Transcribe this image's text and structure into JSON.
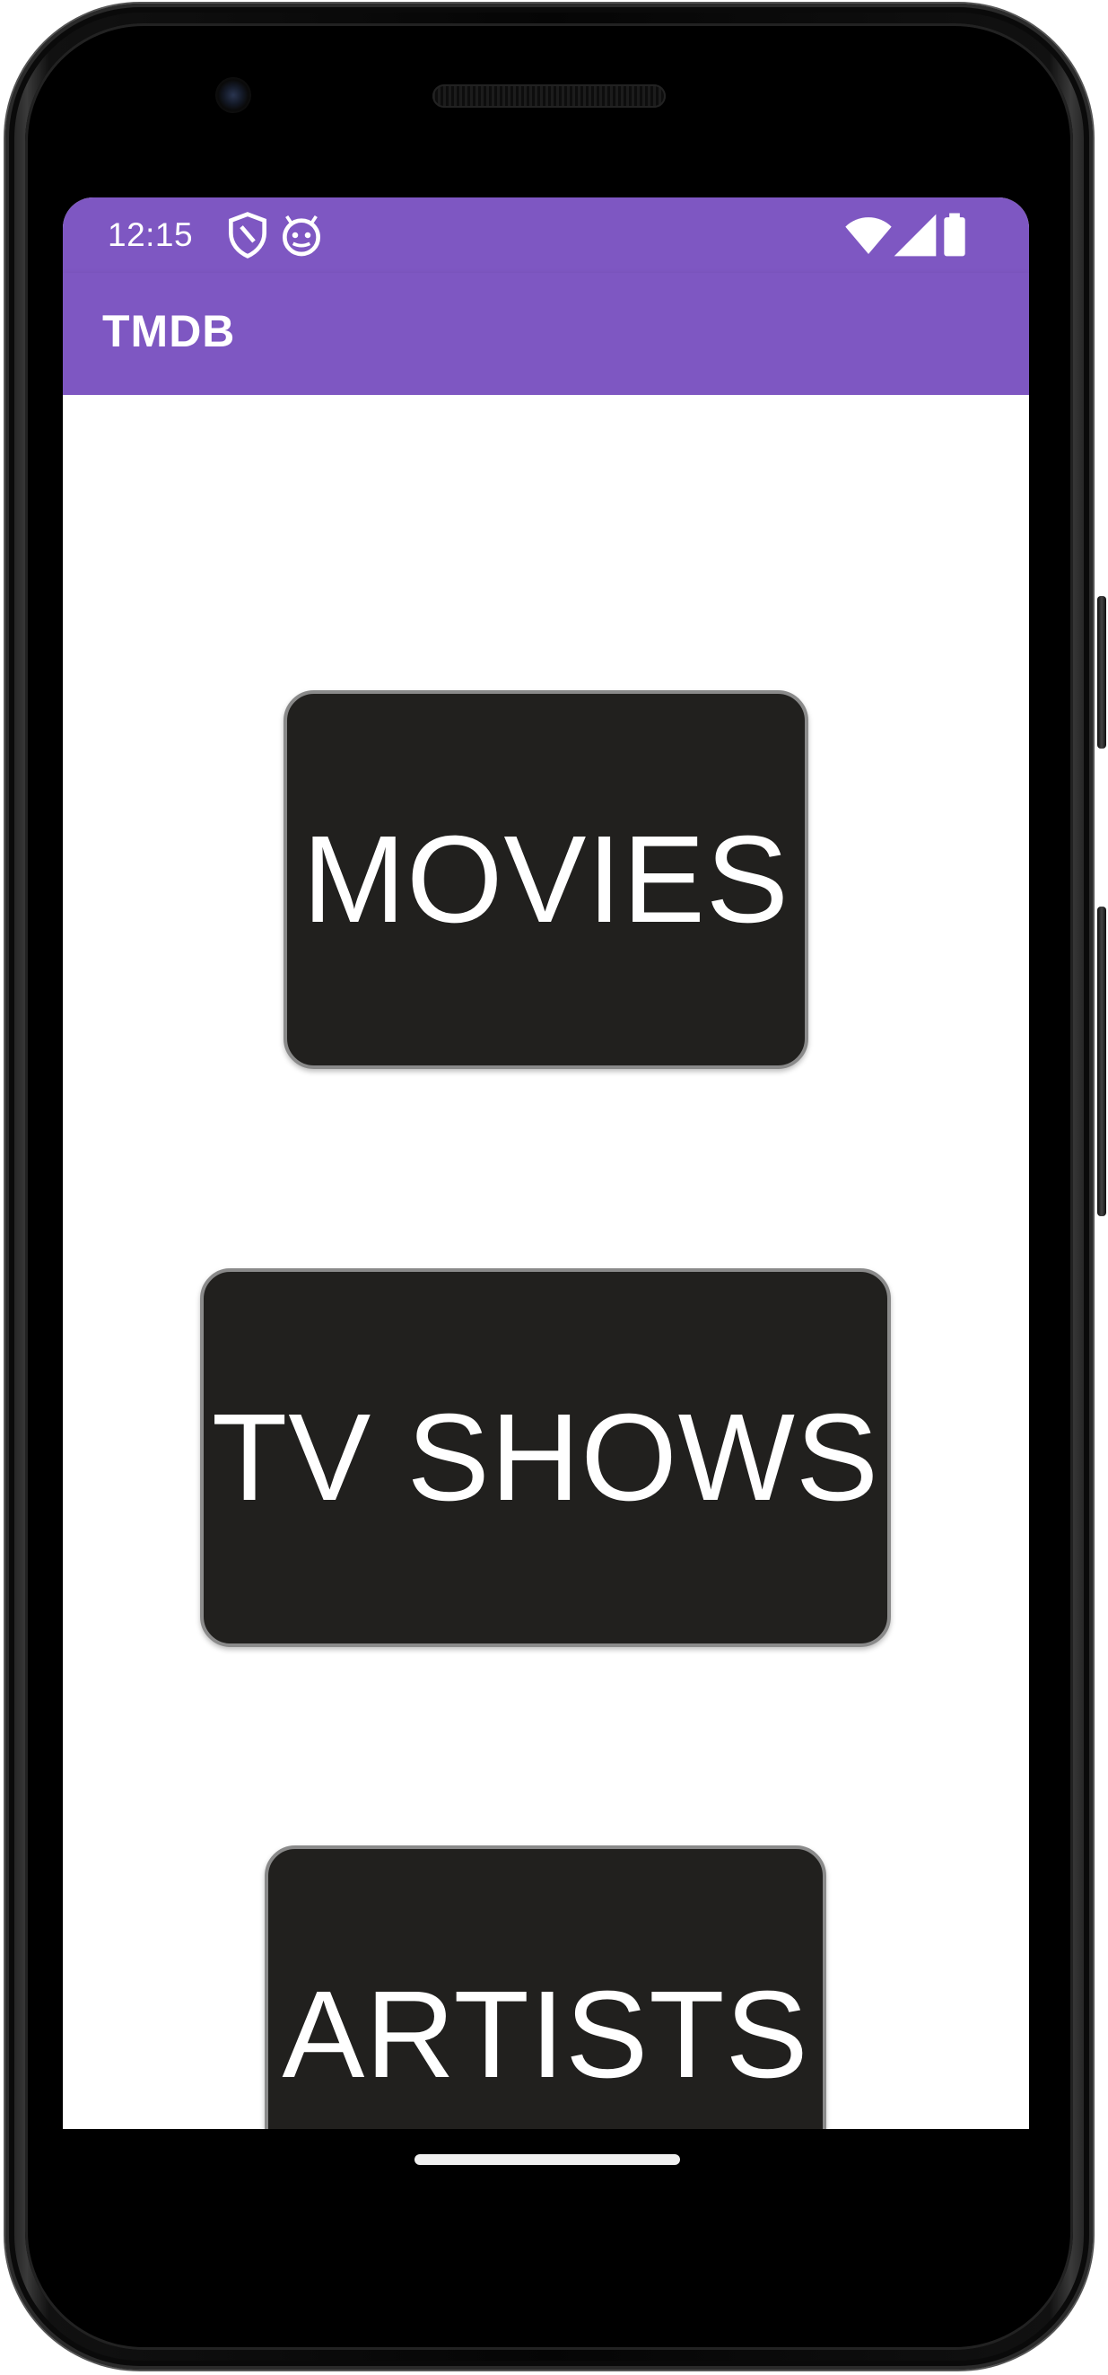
{
  "status_bar": {
    "time": "12:15",
    "left_icons": [
      "shield-icon",
      "android-icon"
    ],
    "right_icons": [
      "wifi-icon",
      "signal-icon",
      "battery-icon"
    ]
  },
  "app_bar": {
    "title": "TMDB"
  },
  "menu": {
    "buttons": [
      {
        "label": "MOVIES"
      },
      {
        "label": "TV SHOWS"
      },
      {
        "label": "ARTISTS"
      }
    ]
  },
  "colors": {
    "app_bar": "#7e57c2",
    "button_background": "#21201e",
    "button_border": "#8a8a8a",
    "button_text": "#ffffff",
    "screen_background": "#ffffff"
  }
}
